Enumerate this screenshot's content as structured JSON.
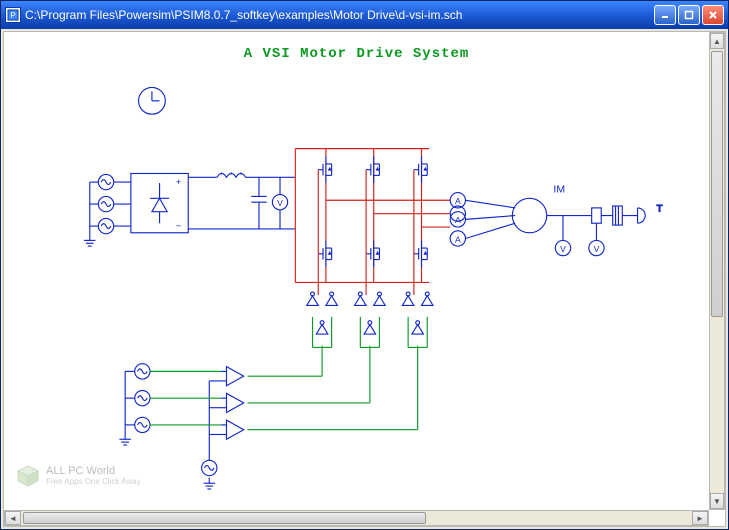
{
  "window": {
    "title": "C:\\Program Files\\Powersim\\PSIM8.0.7_softkey\\examples\\Motor Drive\\d-vsi-im.sch"
  },
  "schematic": {
    "title": "A VSI Motor Drive System",
    "motor_label": "IM",
    "torque_label": "T",
    "ammeter_label": "A",
    "voltmeter_label": "V"
  },
  "watermark": {
    "brand": "ALL PC World",
    "tagline": "Free Apps One Click Away"
  },
  "colors": {
    "wire_blue": "#1428c8",
    "wire_red": "#d2201d",
    "wire_green": "#0d9a22"
  }
}
